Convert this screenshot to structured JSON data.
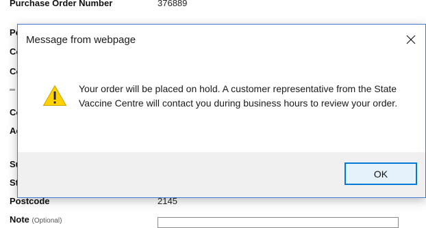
{
  "background_form": {
    "purchase_order_label": "Purchase Order Number",
    "purchase_order_value": "376889",
    "row_fragments": [
      "Po",
      "Co",
      "Co",
      "Co",
      "Ac",
      "Su",
      "St"
    ],
    "postcode_label": "Postcode",
    "postcode_value": "2145",
    "note_label": "Note",
    "note_hint": "(Optional)"
  },
  "dialog": {
    "title": "Message from webpage",
    "message": "Your order will be placed on hold. A customer representative from the State Vaccine Centre will contact you during business hours to review your order.",
    "ok_label": "OK",
    "close_icon": "close-icon",
    "message_icon": "warning-icon",
    "accent_color": "#0078d7",
    "warning_color": "#ffd200"
  }
}
